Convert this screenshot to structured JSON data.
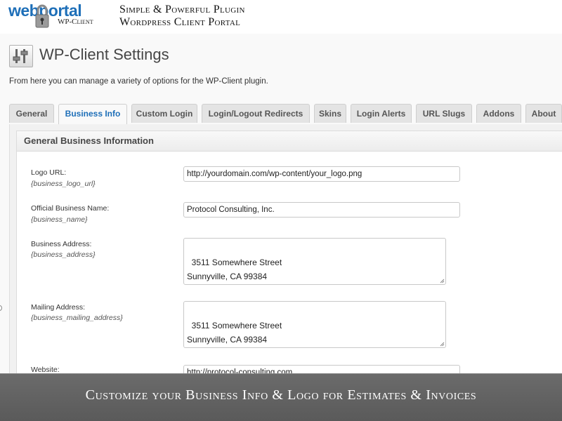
{
  "brand": {
    "logo_web": "web",
    "logo_portal": "portal",
    "logo_sub": "WP-Client",
    "tagline_line1": "Simple & Powerful Plugin",
    "tagline_line2": "Wordpress Client Portal",
    "accent_color": "#1e6fb8"
  },
  "page": {
    "icon": "settings-sliders-icon",
    "title": "WP-Client Settings",
    "intro": "From here you can manage a variety of options for the WP-Client plugin."
  },
  "tabs": [
    {
      "label": "General",
      "active": false
    },
    {
      "label": "Business Info",
      "active": true
    },
    {
      "label": "Custom Login",
      "active": false
    },
    {
      "label": "Login/Logout Redirects",
      "active": false
    },
    {
      "label": "Skins",
      "active": false
    },
    {
      "label": "Login Alerts",
      "active": false
    },
    {
      "label": "URL Slugs",
      "active": false
    },
    {
      "label": "Addons",
      "active": false
    },
    {
      "label": "About",
      "active": false
    }
  ],
  "panel": {
    "header": "General Business Information",
    "fields": {
      "logo": {
        "label": "Logo URL:",
        "token": "{business_logo_url}",
        "value": "http://yourdomain.com/wp-content/your_logo.png"
      },
      "name": {
        "label": "Official Business Name:",
        "token": "{business_name}",
        "value": "Protocol Consulting, Inc."
      },
      "address": {
        "label": "Business Address:",
        "token": "{business_address}",
        "value": "3511 Somewhere Street\nSunnyville, CA 99384"
      },
      "mailing": {
        "label": "Mailing Address:",
        "token": "{business_mailing_address}",
        "value": "3511 Somewhere Street\nSunnyville, CA 99384"
      },
      "website": {
        "label": "Website:",
        "value": "http://protocol-consulting.com"
      }
    }
  },
  "caption": "Customize your Business Info & Logo for Estimates & Invoices"
}
